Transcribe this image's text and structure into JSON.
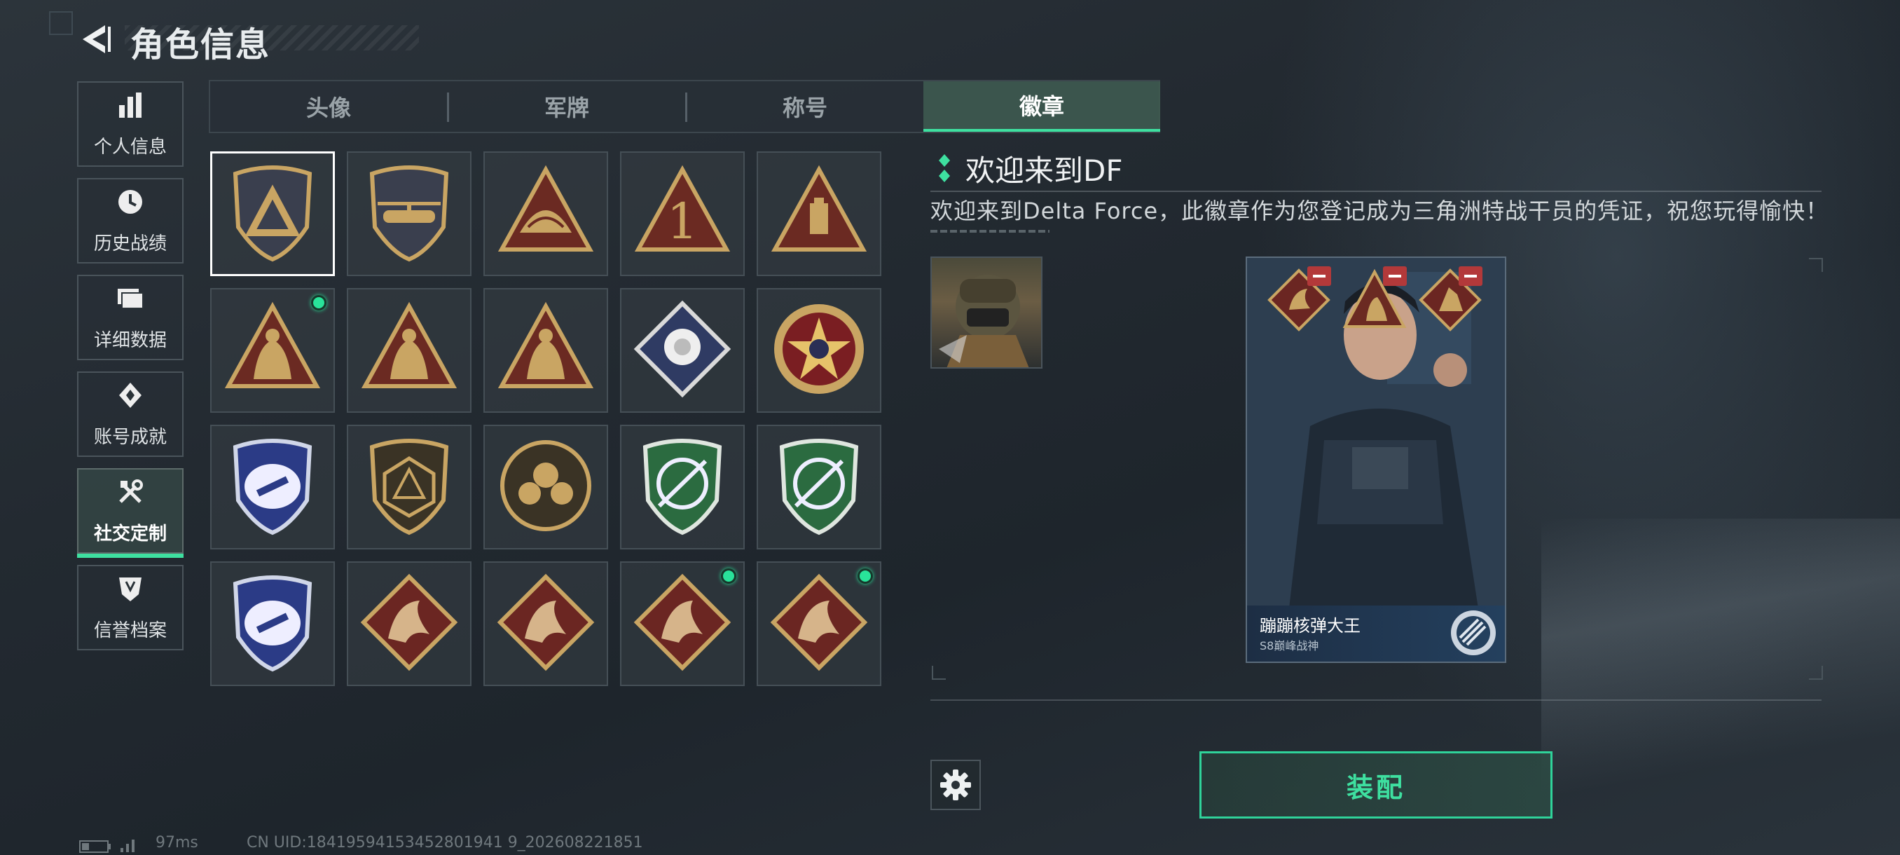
{
  "header": {
    "title": "角色信息"
  },
  "sidebar": {
    "items": [
      {
        "label": "个人信息",
        "icon": "bar-chart-icon"
      },
      {
        "label": "历史战绩",
        "icon": "clock-icon"
      },
      {
        "label": "详细数据",
        "icon": "folder-icon"
      },
      {
        "label": "账号成就",
        "icon": "medal-icon"
      },
      {
        "label": "社交定制",
        "icon": "tools-icon",
        "active": true
      },
      {
        "label": "信誉档案",
        "icon": "shield-icon"
      }
    ]
  },
  "tabs": [
    {
      "label": "头像"
    },
    {
      "label": "军牌"
    },
    {
      "label": "称号"
    },
    {
      "label": "徽章",
      "active": true
    }
  ],
  "badges": [
    {
      "kind": "shield-logo",
      "color": "#3a3f4e"
    },
    {
      "kind": "shield-heli",
      "color": "#3a3f4e"
    },
    {
      "kind": "tri-wings",
      "color": "#6b2a22"
    },
    {
      "kind": "tri-one",
      "color": "#6b2a22"
    },
    {
      "kind": "tri-box",
      "color": "#6b2a22"
    },
    {
      "kind": "tri-figure",
      "color": "#6b2a22",
      "new": true
    },
    {
      "kind": "tri-hands",
      "color": "#6b2a22"
    },
    {
      "kind": "tri-soldiers",
      "color": "#6b2a22"
    },
    {
      "kind": "diamond-rose",
      "color": "#2f3b63"
    },
    {
      "kind": "round-star",
      "color": "#7a1e22"
    },
    {
      "kind": "shield-blue",
      "color": "#2b3b86"
    },
    {
      "kind": "shield-d20",
      "color": "#3a3325"
    },
    {
      "kind": "round-skull",
      "color": "#3a3325"
    },
    {
      "kind": "shield-green",
      "color": "#2b6b40"
    },
    {
      "kind": "shield-green",
      "color": "#2b6b40"
    },
    {
      "kind": "shield-blue-green",
      "color": "#2b3b86"
    },
    {
      "kind": "diamond-wolf",
      "color": "#6b2622"
    },
    {
      "kind": "diamond-dragon",
      "color": "#6b2622"
    },
    {
      "kind": "diamond-dragon",
      "color": "#6b2622",
      "new": true
    },
    {
      "kind": "diamond-runner",
      "color": "#6b2622",
      "new": true
    }
  ],
  "detail": {
    "name": "欢迎来到DF",
    "description": "欢迎来到Delta Force，此徽章作为您登记成为三角洲特战干员的凭证，祝您玩得愉快！"
  },
  "card": {
    "player_name": "蹦蹦核弹大王",
    "subtitle": "S8巅峰战神"
  },
  "actions": {
    "equip_label": "装配"
  },
  "status": {
    "ping": "97ms",
    "uid": "CN UID:18419594153452801941 9_202608221851"
  },
  "colors": {
    "accent": "#3ee0a0",
    "gold": "#c9a563"
  }
}
